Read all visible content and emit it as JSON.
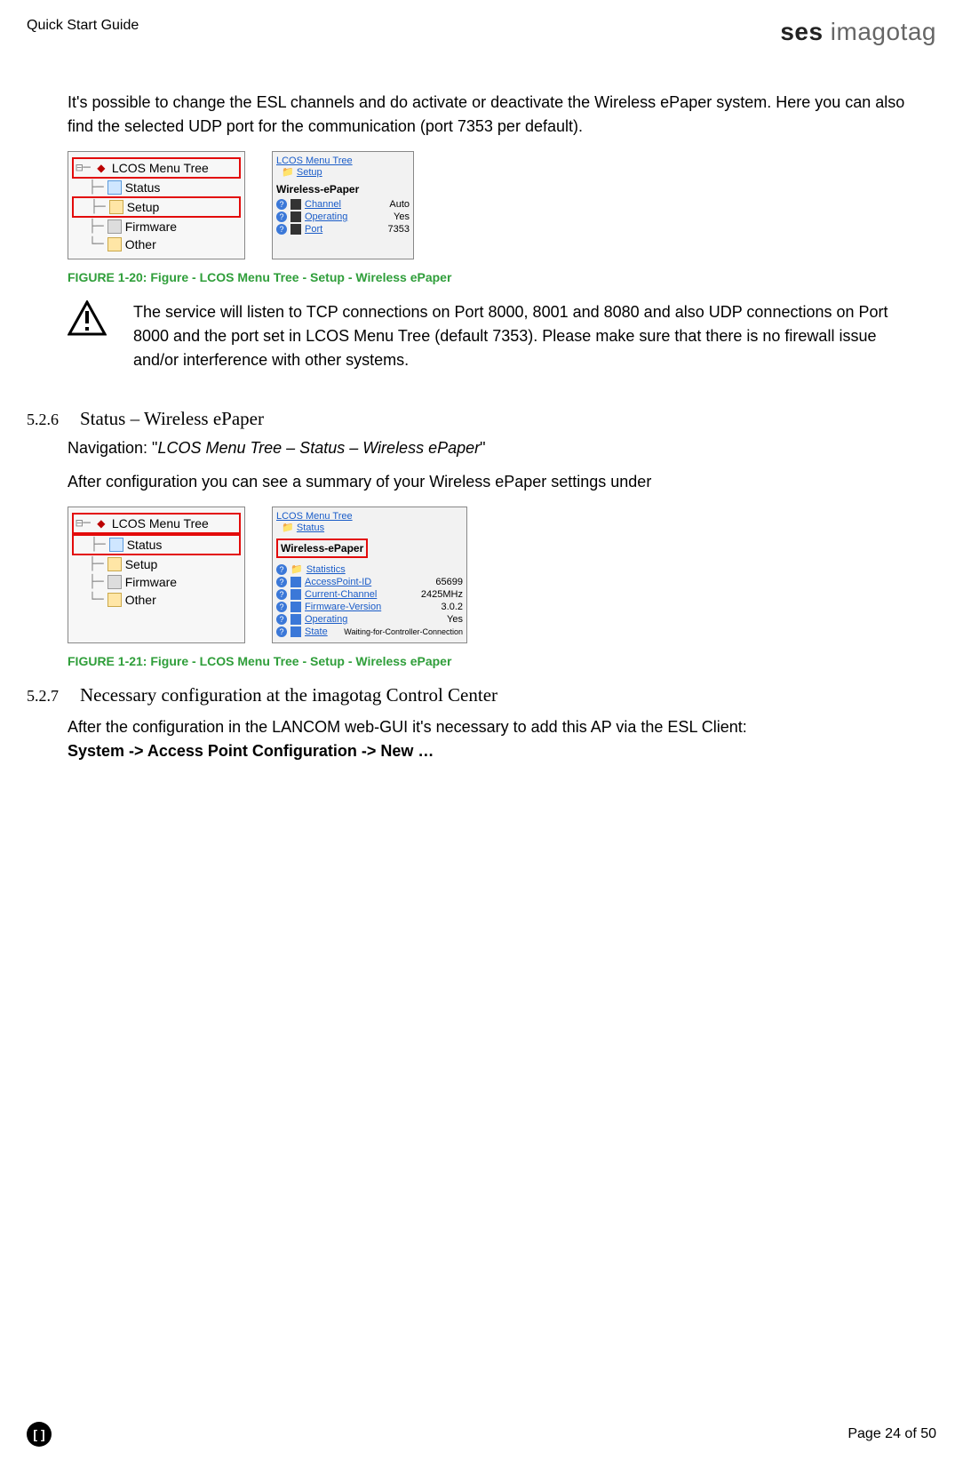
{
  "header": {
    "doc_title": "Quick Start Guide",
    "logo_bold": "ses",
    "logo_light": " imagotag"
  },
  "intro_para": "It's possible to change the ESL channels and do activate or deactivate the Wireless ePaper system. Here you can also find the selected UDP port for the communication (port 7353 per default).",
  "tree1": {
    "root": "LCOS Menu Tree",
    "items": [
      "Status",
      "Setup",
      "Firmware",
      "Other"
    ]
  },
  "detail1": {
    "crumb1": "LCOS Menu Tree",
    "crumb2": "Setup",
    "title": "Wireless-ePaper",
    "rows": [
      {
        "label": "Channel",
        "value": "Auto"
      },
      {
        "label": "Operating",
        "value": "Yes"
      },
      {
        "label": "Port",
        "value": "7353"
      }
    ]
  },
  "caption1": "FIGURE 1-20: Figure - LCOS Menu Tree - Setup - Wireless ePaper",
  "warn_text": "The service will listen to TCP connections on Port 8000, 8001 and 8080 and also UDP connections on Port 8000 and the port set in LCOS Menu Tree (default 7353). Please make sure that there is no firewall issue and/or interference with other systems.",
  "section526": {
    "num": "5.2.6",
    "title": "Status – Wireless ePaper",
    "nav_prefix": "Navigation: \"",
    "nav_path": "LCOS Menu Tree – Status  – Wireless ePaper",
    "nav_suffix": "\"",
    "para": "After configuration you can see a summary of your Wireless ePaper settings under"
  },
  "tree2": {
    "root": "LCOS Menu Tree",
    "items": [
      "Status",
      "Setup",
      "Firmware",
      "Other"
    ]
  },
  "detail2": {
    "crumb1": "LCOS Menu Tree",
    "crumb2": "Status",
    "title": "Wireless-ePaper",
    "stat": "Statistics",
    "rows": [
      {
        "label": "AccessPoint-ID",
        "value": "65699"
      },
      {
        "label": "Current-Channel",
        "value": "2425MHz"
      },
      {
        "label": "Firmware-Version",
        "value": "3.0.2"
      },
      {
        "label": "Operating",
        "value": "Yes"
      },
      {
        "label": "State",
        "value": "Waiting-for-Controller-Connection"
      }
    ]
  },
  "caption2": "FIGURE 1-21: Figure - LCOS Menu Tree - Setup - Wireless ePaper",
  "section527": {
    "num": "5.2.7",
    "title": "Necessary configuration at the imagotag Control Center",
    "para_plain": "After the configuration in the LANCOM web-GUI it's necessary to add this AP via the ESL Client: ",
    "para_bold": "System -> Access Point Configuration -> New …"
  },
  "footer": {
    "badge": "[ ]",
    "page": "Page 24 of 50"
  }
}
